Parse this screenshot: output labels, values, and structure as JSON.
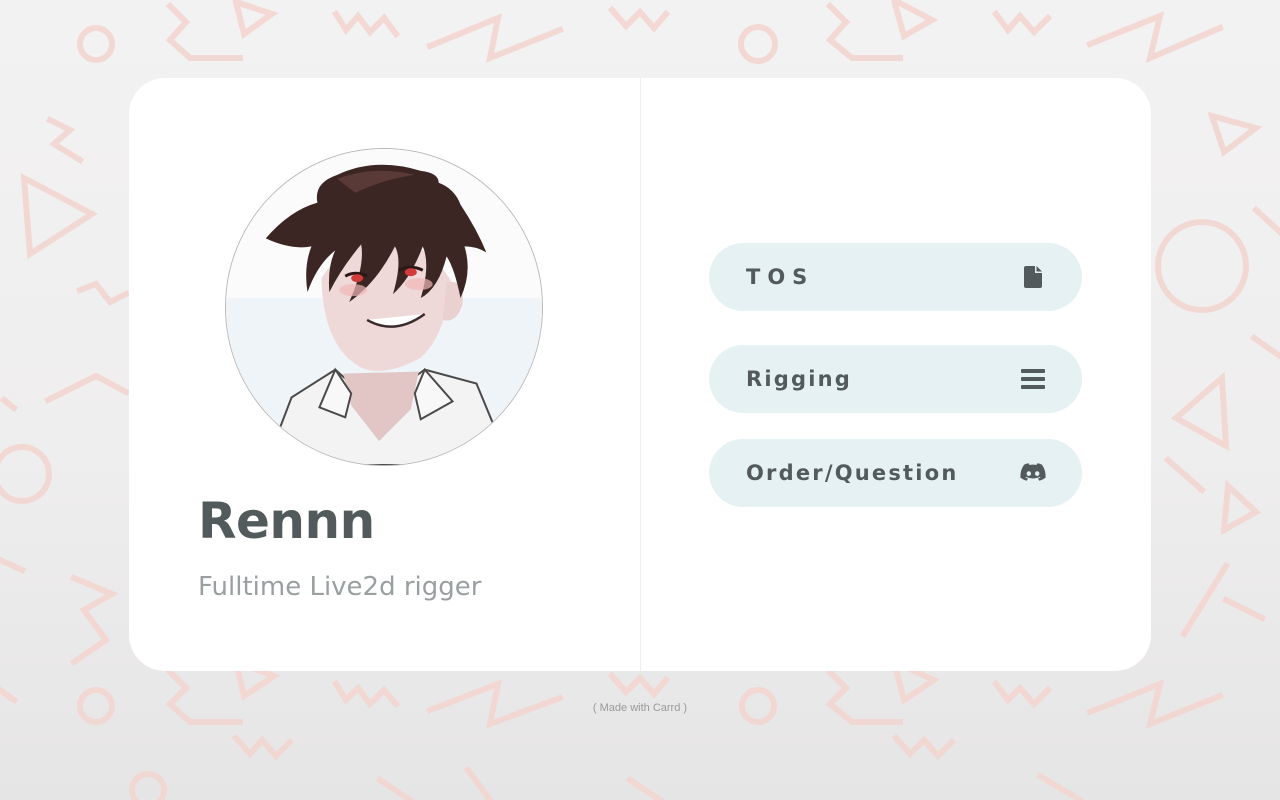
{
  "profile": {
    "name": "Rennn",
    "tagline": "Fulltime Live2d rigger"
  },
  "links": [
    {
      "label": "TOS",
      "icon": "document-icon"
    },
    {
      "label": "Rigging",
      "icon": "menu-lines-icon"
    },
    {
      "label": "Order/Question",
      "icon": "discord-icon"
    }
  ],
  "footer": {
    "credit": "( Made with Carrd )"
  },
  "colors": {
    "card_background": "#ffffff",
    "button_background": "#e5f1f3",
    "button_text": "#525a5c",
    "name_text": "#525a5c",
    "tagline_text": "#9aa0a2",
    "pattern_accent": "#f2cfc8"
  }
}
